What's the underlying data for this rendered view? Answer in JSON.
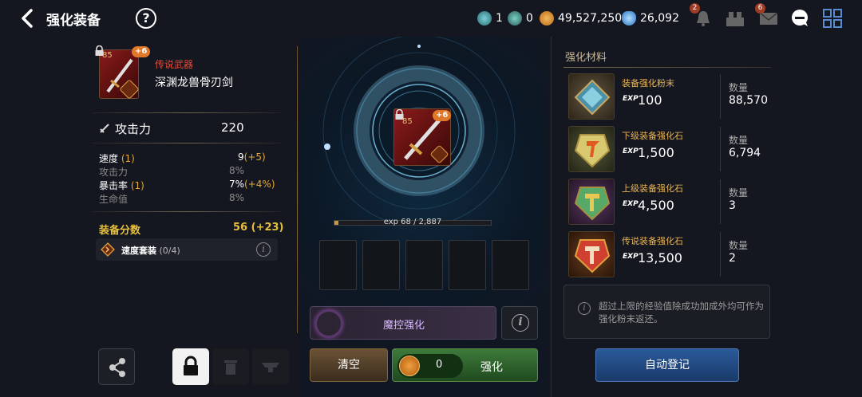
{
  "header": {
    "title": "强化装备",
    "help": "?",
    "currencies": [
      {
        "name": "ticket-a",
        "value": "1",
        "color": "#3a9aa0"
      },
      {
        "name": "ticket-b",
        "value": "0",
        "color": "#3a8a90"
      },
      {
        "name": "gold",
        "value": "49,527,250",
        "color": "#e09030"
      },
      {
        "name": "gem",
        "value": "26,092",
        "color": "#5ab0f0"
      }
    ],
    "badges": {
      "bell": "2",
      "mail": "6"
    }
  },
  "item": {
    "level": "85",
    "plus": "+6",
    "rarity": "传说武器",
    "name": "深渊龙兽骨刃剑",
    "attack_label": "攻击力",
    "attack_value": "220",
    "stats": [
      {
        "label": "速度",
        "bonus_tag": "(1)",
        "value": "9",
        "extra": "(+5)",
        "active": true
      },
      {
        "label": "攻击力",
        "bonus_tag": "",
        "value": "8%",
        "extra": "",
        "active": false
      },
      {
        "label": "暴击率",
        "bonus_tag": "(1)",
        "value": "7%",
        "extra": "(+4%)",
        "active": true
      },
      {
        "label": "生命值",
        "bonus_tag": "",
        "value": "8%",
        "extra": "",
        "active": false
      }
    ],
    "score_label": "装备分数",
    "score_value": "56",
    "score_extra": "(+23)",
    "set_label": "速度套装",
    "set_progress": "(0/4)"
  },
  "center": {
    "exp_text": "exp 68 / 2,887",
    "exp_fraction": 0.024,
    "slot_count": 5,
    "magic_label": "魔控强化",
    "clear_label": "清空",
    "cost_value": "0",
    "enhance_label": "强化"
  },
  "materials": {
    "title": "强化材料",
    "exp_prefix": "EXP",
    "qty_label": "数量",
    "items": [
      {
        "name": "装备强化粉末",
        "exp": "100",
        "qty": "88,570",
        "color": "#6aa8c0"
      },
      {
        "name": "下级装备强化石",
        "exp": "1,500",
        "qty": "6,794",
        "color": "#d8c060"
      },
      {
        "name": "上级装备强化石",
        "exp": "4,500",
        "qty": "3",
        "color": "#60b070"
      },
      {
        "name": "传说装备强化石",
        "exp": "13,500",
        "qty": "2",
        "color": "#d04030"
      }
    ],
    "note": "超过上限的经验值除成功加成外均可作为强化粉末返还。",
    "auto_label": "自动登记"
  }
}
